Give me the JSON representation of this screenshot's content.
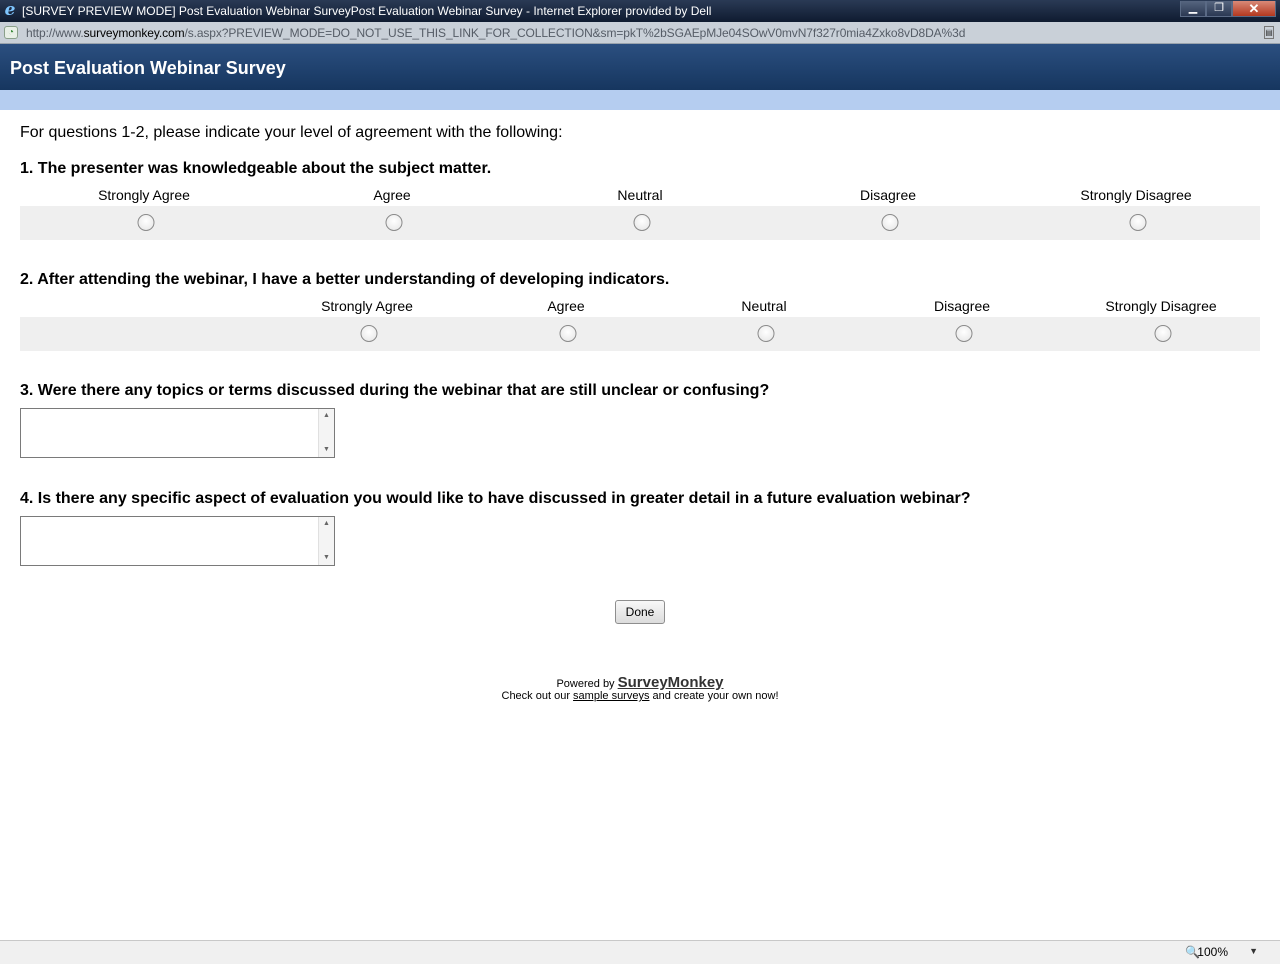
{
  "window": {
    "title": "[SURVEY PREVIEW MODE] Post Evaluation Webinar SurveyPost Evaluation Webinar Survey - Internet Explorer provided by Dell",
    "minimize": "▁",
    "restore": "❐",
    "close": "✕"
  },
  "address": {
    "prefix": "http://www.",
    "host": "surveymonkey.com",
    "path": "/s.aspx?PREVIEW_MODE=DO_NOT_USE_THIS_LINK_FOR_COLLECTION&sm=pkT%2bSGAEpMJe04SOwV0mvN7f327r0mia4Zxko8vD8DA%3d"
  },
  "survey": {
    "title": "Post Evaluation Webinar Survey",
    "intro": "For questions 1-2, please indicate your level of agreement with the following:",
    "q1": {
      "title": "1. The presenter was knowledgeable about the subject matter.",
      "options": [
        "Strongly Agree",
        "Agree",
        "Neutral",
        "Disagree",
        "Strongly Disagree"
      ]
    },
    "q2": {
      "title": "2. After attending the webinar, I have a better understanding of developing indicators.",
      "options": [
        "Strongly Agree",
        "Agree",
        "Neutral",
        "Disagree",
        "Strongly Disagree"
      ]
    },
    "q3": {
      "title": "3. Were there any topics or terms discussed during the webinar that are still unclear or confusing?",
      "value": ""
    },
    "q4": {
      "title": "4. Is there any specific aspect of evaluation you would like to have discussed in greater detail in a future evaluation webinar?",
      "value": ""
    },
    "done_label": "Done"
  },
  "footer": {
    "powered_by": "Powered by",
    "brand": "SurveyMonkey",
    "checkout_pre": "Check out our",
    "checkout_link": "sample surveys",
    "checkout_post": "and create your own now!"
  },
  "status": {
    "zoom": "100%"
  }
}
